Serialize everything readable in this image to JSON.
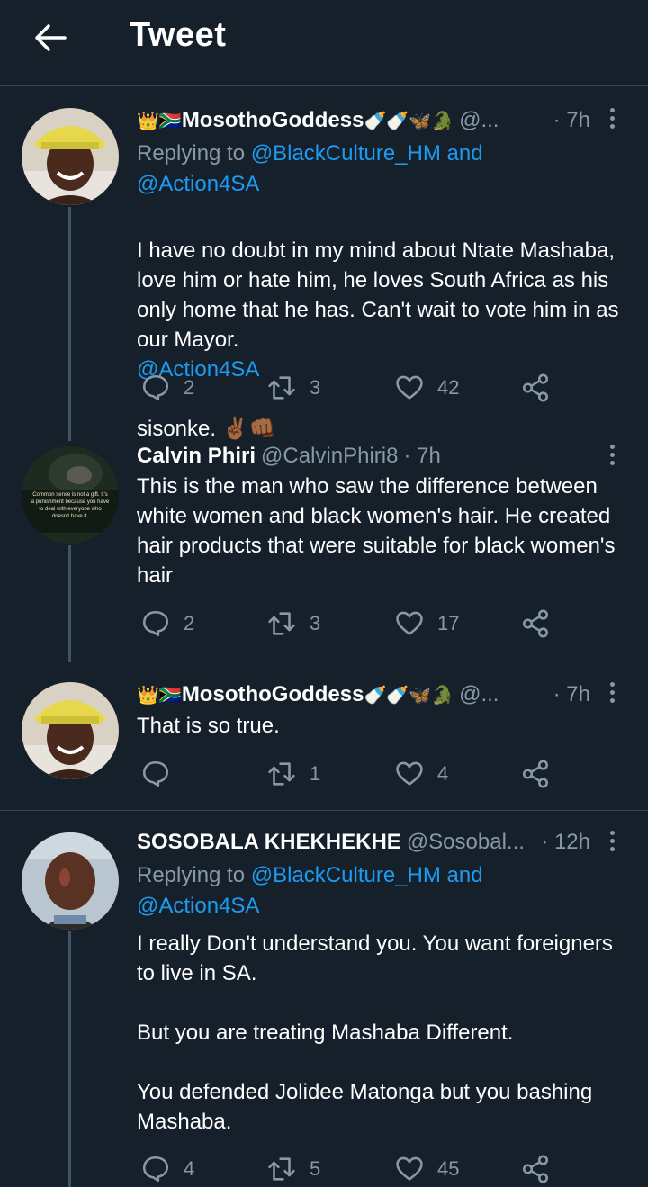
{
  "header": {
    "title": "Tweet"
  },
  "tweets": [
    {
      "name": "MosothoGoddess",
      "prefix_emoji": "👑🇿🇦",
      "suffix_emoji": "🍼🍼🦋🐊",
      "handle": "@...",
      "time": "· 7h",
      "reply_label": "Replying to",
      "reply_user1": "@BlackCulture_HM",
      "reply_and": "and",
      "reply_user2": "@Action4SA",
      "text": "I have no doubt in my mind about Ntate Mashaba, love him or hate him, he loves South Africa as his only home that he has. Can't wait to vote him in as our Mayor.",
      "text_mention": "@Action4SA",
      "text_tail": "sisonke. ✌🏾👊🏾",
      "replies": "2",
      "retweets": "3",
      "likes": "42"
    },
    {
      "name": "Calvin Phiri",
      "handle": "@CalvinPhiri8",
      "time": "· 7h",
      "avatar_text": "Common sense is not a gift. It's a punishment because you have to deal with everyone who doesn't have it.",
      "text": "This is the man who saw the difference between white women and black women's hair. He created hair products that were suitable for black women's hair",
      "replies": "2",
      "retweets": "3",
      "likes": "17"
    },
    {
      "name": "MosothoGoddess",
      "prefix_emoji": "👑🇿🇦",
      "suffix_emoji": "🍼🍼🦋🐊",
      "handle": "@...",
      "time": "· 7h",
      "text": "That is so true.",
      "replies": "",
      "retweets": "1",
      "likes": "4"
    },
    {
      "name": "SOSOBALA KHEKHEKHE",
      "handle": "@Sosobal...",
      "time": "· 12h",
      "reply_label": "Replying to",
      "reply_user1": "@BlackCulture_HM",
      "reply_and": "and",
      "reply_user2": "@Action4SA",
      "text": "I really Don't understand you. You want foreigners to live in SA.\n\nBut you are treating Mashaba Different.\n\nYou defended Jolidee Matonga but you bashing Mashaba.",
      "replies": "4",
      "retweets": "5",
      "likes": "45"
    }
  ],
  "colors": {
    "background": "#15202b",
    "link": "#1d9bf0",
    "muted": "#8899a6",
    "divider": "#38444d"
  }
}
